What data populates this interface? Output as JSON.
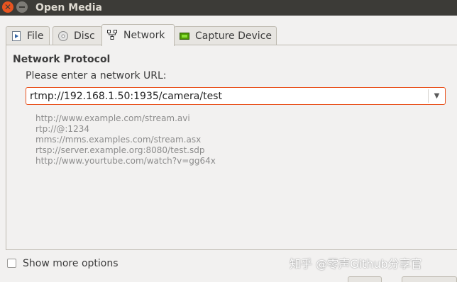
{
  "window": {
    "title": "Open Media",
    "close_glyph": "✕"
  },
  "tabs": [
    {
      "label": "File",
      "icon": "file-icon",
      "active": false
    },
    {
      "label": "Disc",
      "icon": "disc-icon",
      "active": false
    },
    {
      "label": "Network",
      "icon": "network-icon",
      "active": true
    },
    {
      "label": "Capture Device",
      "icon": "capture-device-icon",
      "active": false
    }
  ],
  "network": {
    "group_title": "Network Protocol",
    "prompt": "Please enter a network URL:",
    "url_value": "rtmp://192.168.1.50:1935/camera/test",
    "examples": [
      "http://www.example.com/stream.avi",
      "rtp://@:1234",
      "mms://mms.examples.com/stream.asx",
      "rtsp://server.example.org:8080/test.sdp",
      "http://www.yourtube.com/watch?v=gg64x"
    ]
  },
  "options": {
    "show_more_label": "Show more options",
    "show_more_checked": false
  },
  "watermark": "知乎 @零声Github分享官",
  "colors": {
    "accent": "#e95420",
    "titlebar": "#3c3b37",
    "window_bg": "#f2f1f0"
  }
}
